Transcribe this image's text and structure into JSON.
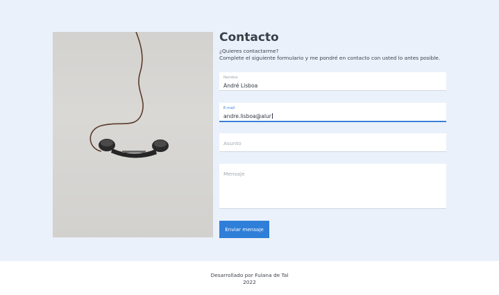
{
  "contact": {
    "title": "Contacto",
    "intro_line1": "¿Quieres contactarme?",
    "intro_line2": "Complete el siguiente formulario y me pondré en contacto con usted lo antes posible."
  },
  "form": {
    "name": {
      "label": "Nombre",
      "value": "André Lisboa"
    },
    "email": {
      "label": "E-mail",
      "value": "andre.lisboa@alur"
    },
    "subject": {
      "placeholder": "Asunto"
    },
    "message": {
      "placeholder": "Mensaje"
    },
    "submit_label": "Enviar mensaje"
  },
  "colors": {
    "accent": "#2f7ed8",
    "page_bg": "#eaf1fb"
  },
  "footer": {
    "credit": "Desarrollado por Fulana de Tal",
    "year": "2022"
  }
}
